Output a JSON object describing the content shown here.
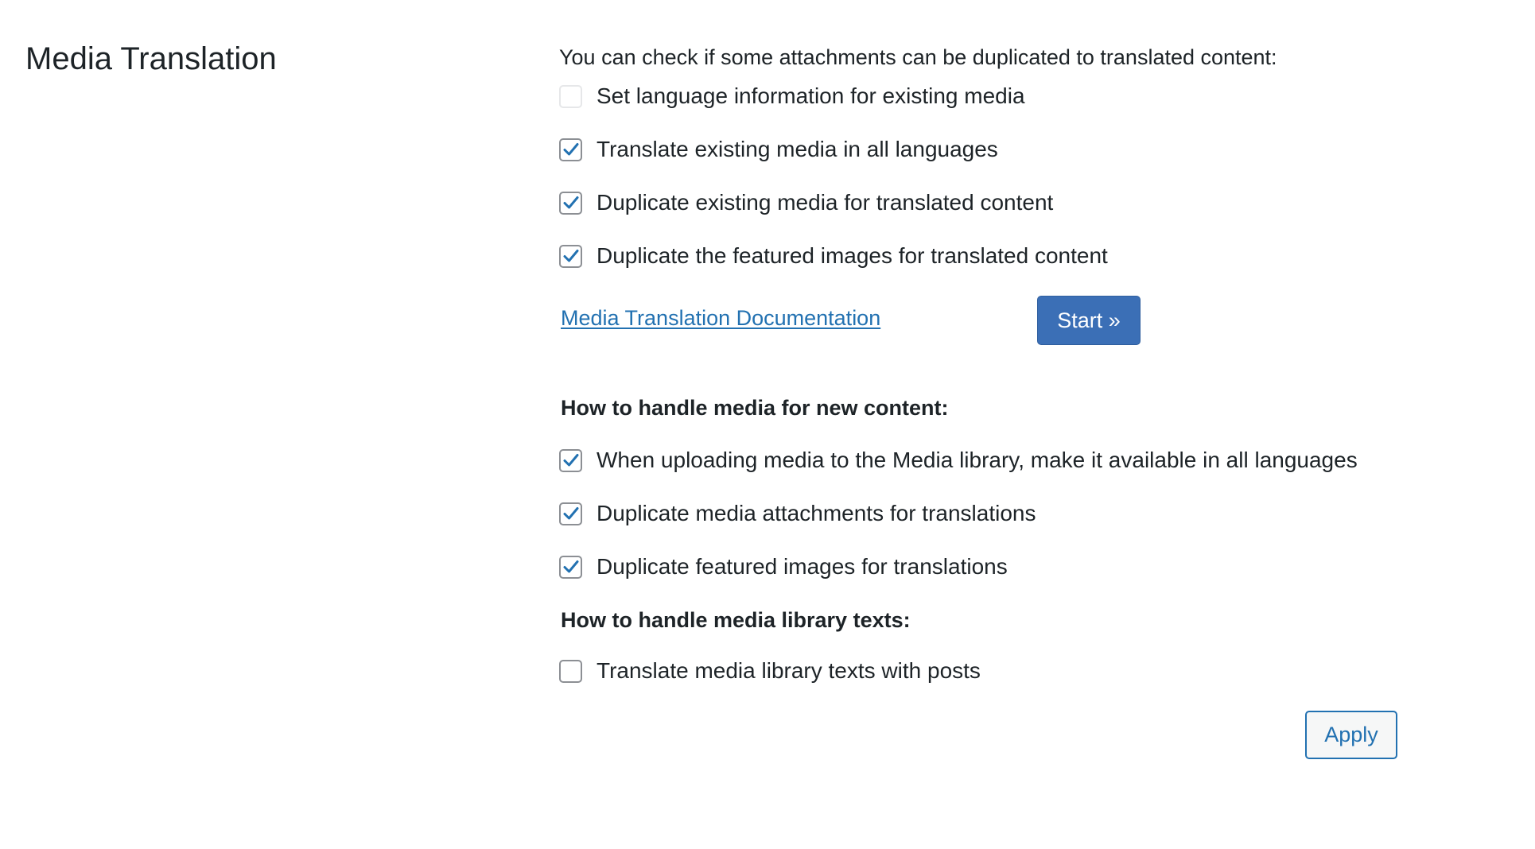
{
  "section": {
    "title": "Media Translation"
  },
  "existing_media": {
    "intro": "You can check if some attachments can be duplicated to translated content:",
    "options": [
      {
        "label": "Set language information for existing media",
        "checked": false,
        "disabled": true
      },
      {
        "label": "Translate existing media in all languages",
        "checked": true,
        "disabled": false
      },
      {
        "label": "Duplicate existing media for translated content",
        "checked": true,
        "disabled": false
      },
      {
        "label": "Duplicate the featured images for translated content",
        "checked": true,
        "disabled": false
      }
    ],
    "doc_link": "Media Translation Documentation",
    "start_button": "Start »"
  },
  "new_content": {
    "heading": "How to handle media for new content:",
    "options": [
      {
        "label": "When uploading media to the Media library, make it available in all languages",
        "checked": true
      },
      {
        "label": "Duplicate media attachments for translations",
        "checked": true
      },
      {
        "label": "Duplicate featured images for translations",
        "checked": true
      }
    ]
  },
  "library_texts": {
    "heading": "How to handle media library texts:",
    "options": [
      {
        "label": "Translate media library texts with posts",
        "checked": false
      }
    ]
  },
  "apply_button": "Apply",
  "colors": {
    "accent": "#2271b1",
    "primary_button": "#3b6fb6",
    "text": "#1d2327",
    "checkbox_border": "#8c8f94"
  }
}
